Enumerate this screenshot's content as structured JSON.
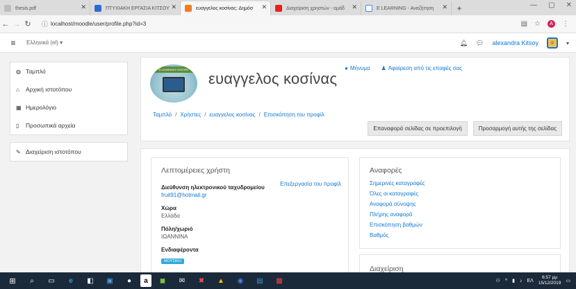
{
  "browser": {
    "tabs": [
      {
        "label": "thesis.pdf",
        "active": false,
        "color": "#9e9e9e"
      },
      {
        "label": "ΠΤΥΧΙΑΚΗ ΕΡΓΑΣΙΑ ΚΙΤΣΟΥ",
        "active": false,
        "color": "#2b6cd4"
      },
      {
        "label": "ευαγγελος κοσίνας: Δημόσ",
        "active": true,
        "color": "#f47b20"
      },
      {
        "label": "Διαχείριση χρηστών - ομάδ",
        "active": false,
        "color": "#e62117"
      },
      {
        "label": "E LEARNING - Αναζήτηση",
        "active": false,
        "color": "#4285f4"
      }
    ],
    "url": "localhost/moodle/user/profile.php?id=3",
    "ext_badge": "A"
  },
  "navbar": {
    "language": "Ελληνικά (el) ▾",
    "username": "alexandra Kitsoy",
    "dropdown": "▾"
  },
  "drawer": {
    "items": [
      {
        "label": "Ταμπλό",
        "icon": "dashboard-icon",
        "glyph": "◍"
      },
      {
        "label": "Αρχική ιστοτόπου",
        "icon": "home-icon",
        "glyph": "⌂"
      },
      {
        "label": "Ημερολόγιο",
        "icon": "calendar-icon",
        "glyph": "▦"
      },
      {
        "label": "Προσωπικά αρχεία",
        "icon": "file-icon",
        "glyph": "▯"
      }
    ],
    "admin_item": {
      "label": "Διαχείριση ιστοτόπου",
      "icon": "wrench-icon",
      "glyph": "✎"
    }
  },
  "header": {
    "cover_text": "E-LEARNING CENTRE",
    "title": "ευαγγελος κοσίνας",
    "message_link": "Μήνυμα",
    "remove_contact_link": "Αφαίρεση από τις επαφές σας",
    "breadcrumb": [
      "Ταμπλό",
      "Χρήστες",
      "ευαγγελος κοσίνας",
      "Επισκόπηση του προφίλ"
    ],
    "reset_button": "Επαναφορά σελίδας σε προεπιλογή",
    "customize_button": "Προσαρμογή αυτής της σελίδας"
  },
  "user_details": {
    "title": "Λεπτομέρειες χρήστη",
    "edit_link": "Επεξεργασία του προφίλ",
    "email_label": "Διεύθυνση ηλεκτρονικού ταχυδρομείου",
    "email_value": "fruit91@hotmail.gr",
    "country_label": "Χώρα",
    "country_value": "Ελλάδα",
    "city_label": "Πόλη/χωριό",
    "city_value": "ΙΩΑΝΝΙΝΑ",
    "interests_label": "Ενδιαφέροντα",
    "interest_tag": "ΜΟΥΣΙΚΗ"
  },
  "reports": {
    "title": "Αναφορές",
    "links": [
      "Σημερινές καταγραφές",
      "Όλες οι καταγραφές",
      "Αναφορά σύνοψης",
      "Πλήρης αναφορά",
      "Επισκόπηση βαθμών",
      "Βαθμός"
    ]
  },
  "administration": {
    "title": "Διαχείριση"
  },
  "taskbar": {
    "lang": "ΕΛ",
    "time": "6:57 μμ",
    "date": "15/12/2019"
  }
}
